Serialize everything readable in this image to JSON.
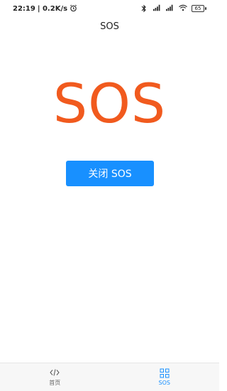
{
  "status": {
    "time": "22:19",
    "speed": "| 0.2K/s",
    "battery": "65",
    "icons": [
      "alarm-icon",
      "bluetooth-icon",
      "signal-icon",
      "signal-hd-icon",
      "wifi-icon",
      "battery-icon"
    ]
  },
  "header": {
    "title": "SOS"
  },
  "main": {
    "sos_text": "SOS",
    "sos_color": "#f15a1e",
    "close_button_label": "关闭 SOS",
    "button_color": "#1890ff"
  },
  "tabs": [
    {
      "label": "首页",
      "icon": "code-icon",
      "active": false
    },
    {
      "label": "SOS",
      "icon": "grid-icon",
      "active": true
    }
  ]
}
